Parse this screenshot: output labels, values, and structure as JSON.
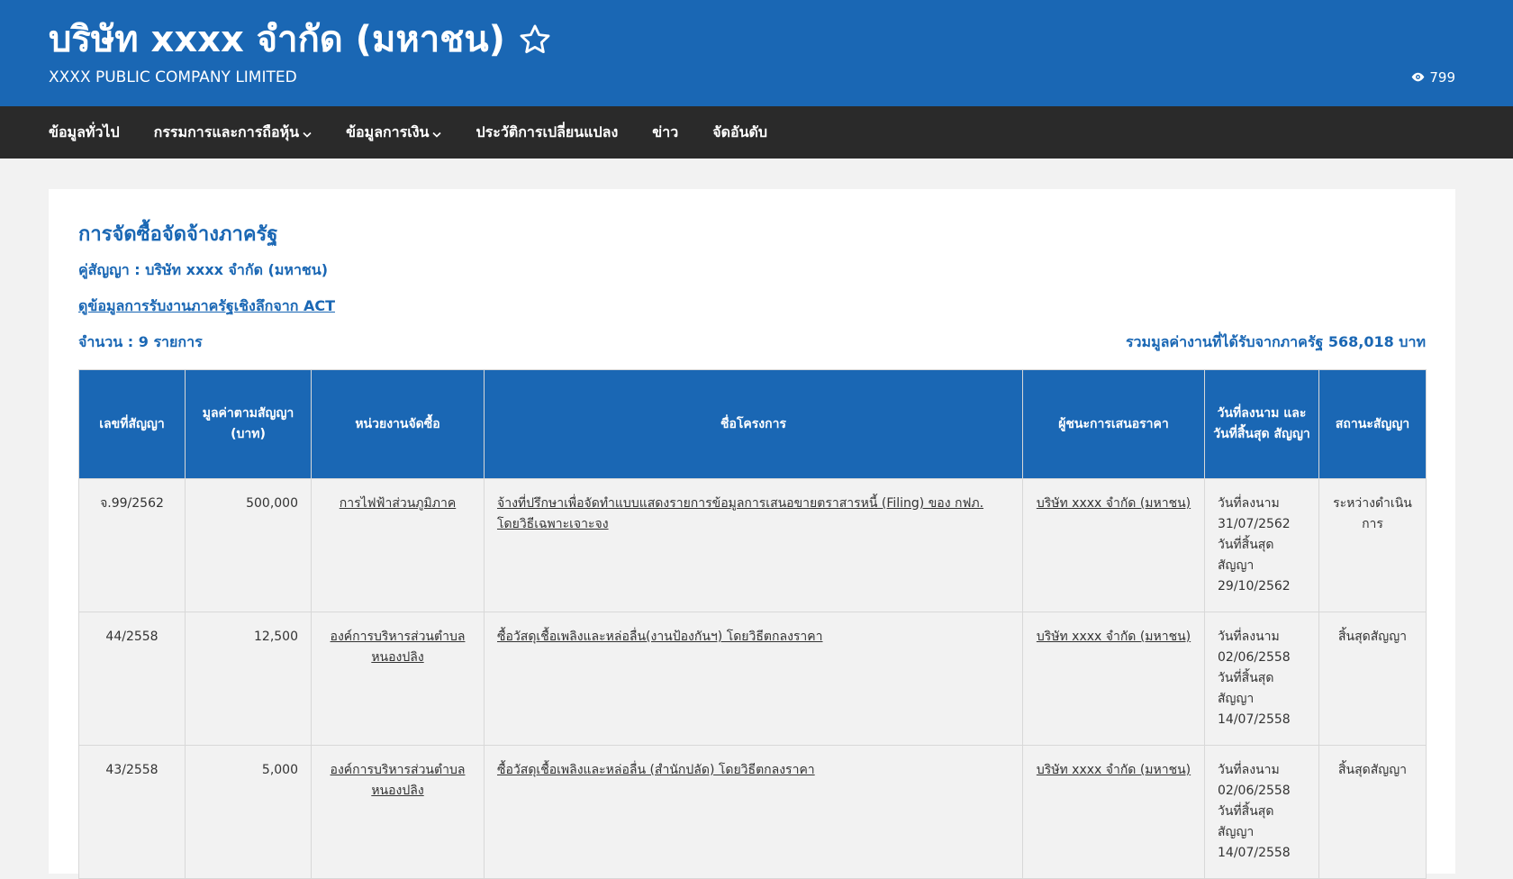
{
  "header": {
    "title": "บริษัท xxxx จำกัด (มหาชน)",
    "subtitle": "XXXX PUBLIC COMPANY LIMITED",
    "views": "799"
  },
  "nav": {
    "items": [
      {
        "label": "ข้อมูลทั่วไป",
        "dropdown": false
      },
      {
        "label": "กรรมการและการถือหุ้น",
        "dropdown": true
      },
      {
        "label": "ข้อมูลการเงิน",
        "dropdown": true
      },
      {
        "label": "ประวัติการเปลี่ยนแปลง",
        "dropdown": false
      },
      {
        "label": "ข่าว",
        "dropdown": false
      },
      {
        "label": "จัดอันดับ",
        "dropdown": false
      }
    ]
  },
  "main": {
    "title": "การจัดซื้อจัดจ้างภาครัฐ",
    "party": "คู่สัญญา : บริษัท xxxx จำกัด (มหาชน)",
    "act_link": "ดูข้อมูลการรับงานภาครัฐเชิงลึกจาก ACT",
    "count": "จำนวน : 9 รายการ",
    "total": "รวมมูลค่างานที่ได้รับจากภาครัฐ 568,018 บาท"
  },
  "table": {
    "headers": {
      "contract_no": "เลขที่สัญญา",
      "value": "มูลค่าตามสัญญา (บาท)",
      "agency": "หน่วยงานจัดซื้อ",
      "project": "ชื่อโครงการ",
      "winner": "ผู้ชนะการเสนอราคา",
      "dates": "วันที่ลงนาม และ วันที่สิ้นสุด สัญญา",
      "status": "สถานะสัญญา"
    },
    "rows": [
      {
        "contract_no": "จ.99/2562",
        "value": "500,000",
        "agency": "การไฟฟ้าส่วนภูมิภาค",
        "project": "จ้างที่ปรึกษาเพื่อจัดทำแบบแสดงรายการข้อมูลการเสนอขายตราสารหนี้ (Filing) ของ กฟภ. โดยวิธีเฉพาะเจาะจง",
        "winner": "บริษัท xxxx จำกัด (มหาชน)",
        "dates": "วันที่ลงนาม 31/07/2562 วันที่สิ้นสุดสัญญา 29/10/2562",
        "status": "ระหว่างดำเนินการ"
      },
      {
        "contract_no": "44/2558",
        "value": "12,500",
        "agency": "องค์การบริหารส่วนตำบลหนองปลิง",
        "project": "ซื้อวัสดุเชื้อเพลิงและหล่อลื่น(งานป้องกันฯ) โดยวิธีตกลงราคา",
        "winner": "บริษัท xxxx จำกัด (มหาชน)",
        "dates": "วันที่ลงนาม 02/06/2558 วันที่สิ้นสุดสัญญา 14/07/2558",
        "status": "สิ้นสุดสัญญา"
      },
      {
        "contract_no": "43/2558",
        "value": "5,000",
        "agency": "องค์การบริหารส่วนตำบลหนองปลิง",
        "project": "ซื้อวัสดุเชื้อเพลิงและหล่อลื่น (สำนักปลัด) โดยวิธีตกลงราคา",
        "winner": "บริษัท xxxx จำกัด (มหาชน)",
        "dates": "วันที่ลงนาม 02/06/2558 วันที่สิ้นสุดสัญญา 14/07/2558",
        "status": "สิ้นสุดสัญญา"
      }
    ]
  },
  "colors": {
    "brand_blue": "#1a67b4",
    "nav_dark": "#2a2a2a",
    "page_bg": "#f2f2f2"
  },
  "icons": {
    "favorite": "star-icon",
    "views": "eye-icon",
    "dropdown": "chevron-down-icon"
  }
}
